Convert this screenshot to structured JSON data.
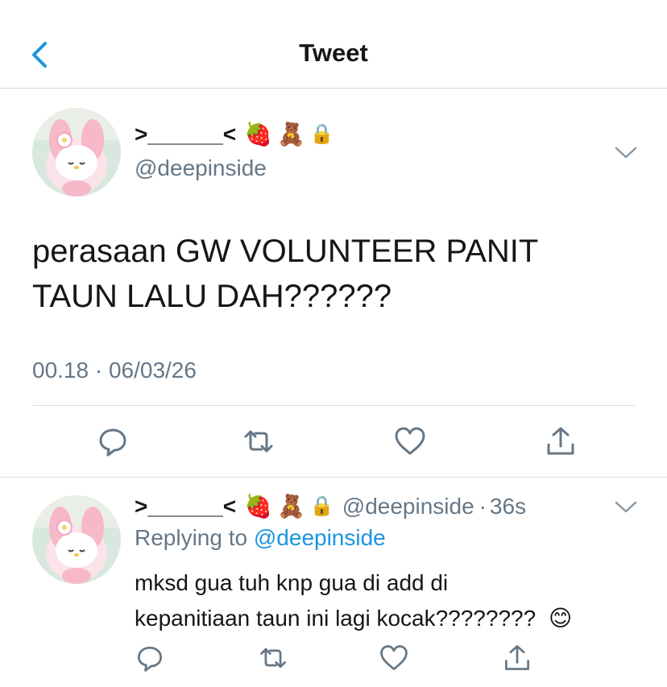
{
  "header": {
    "title": "Tweet",
    "back_icon": "chevron-left-icon"
  },
  "colors": {
    "accent": "#1b95e0",
    "secondary_text": "#657786",
    "divider": "#d8dde1"
  },
  "main_tweet": {
    "display_name": ">______<",
    "name_emojis": [
      "🍓",
      "🧸",
      "🔒"
    ],
    "handle": "@deepinside",
    "text_line1": "perasaan GW VOLUNTEER PANIT",
    "text_line2": "TAUN LALU DAH??????",
    "timestamp": "00.18 · 06/03/26",
    "actions": [
      "reply-icon",
      "retweet-icon",
      "like-icon",
      "share-icon"
    ]
  },
  "reply_tweet": {
    "display_name": ">______<",
    "name_emojis": [
      "🍓",
      "🧸",
      "🔒"
    ],
    "handle": "@deepinside",
    "separator": "·",
    "age": "36s",
    "replying_prefix": "Replying to",
    "replying_to": "@deepinside",
    "text_line1": "mksd gua tuh knp gua di add di",
    "text_line2": "kepanitiaan taun ini lagi kocak????????",
    "text_emoji": "😊",
    "actions": [
      "reply-icon",
      "retweet-icon",
      "like-icon",
      "share-icon"
    ]
  }
}
